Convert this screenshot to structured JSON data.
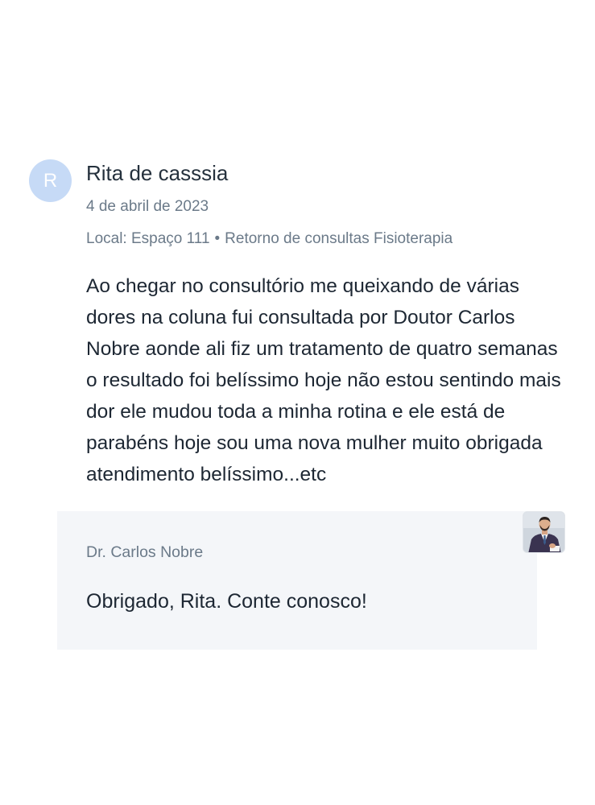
{
  "review": {
    "avatar_initial": "R",
    "author": "Rita de casssia",
    "date": "4 de abril de 2023",
    "location": "Local: Espaço 111",
    "separator": "•",
    "service": "Retorno de consultas Fisioterapia",
    "text": "Ao chegar no consultório me queixando de várias dores na coluna fui consultada por Doutor Carlos Nobre aonde ali fiz um tratamento de quatro semanas o resultado foi belíssimo hoje não estou sentindo mais dor ele mudou toda a minha rotina e ele está de parabéns hoje sou uma nova mulher muito obrigada atendimento belíssimo...etc"
  },
  "reply": {
    "author": "Dr. Carlos Nobre",
    "text": "Obrigado, Rita. Conte conosco!",
    "avatar_icon": "doctor-photo-icon"
  },
  "colors": {
    "avatar_bg": "#c6daf6",
    "reply_bg": "#f4f6f9",
    "muted_text": "#6b7a89",
    "body_text": "#1d2733"
  }
}
